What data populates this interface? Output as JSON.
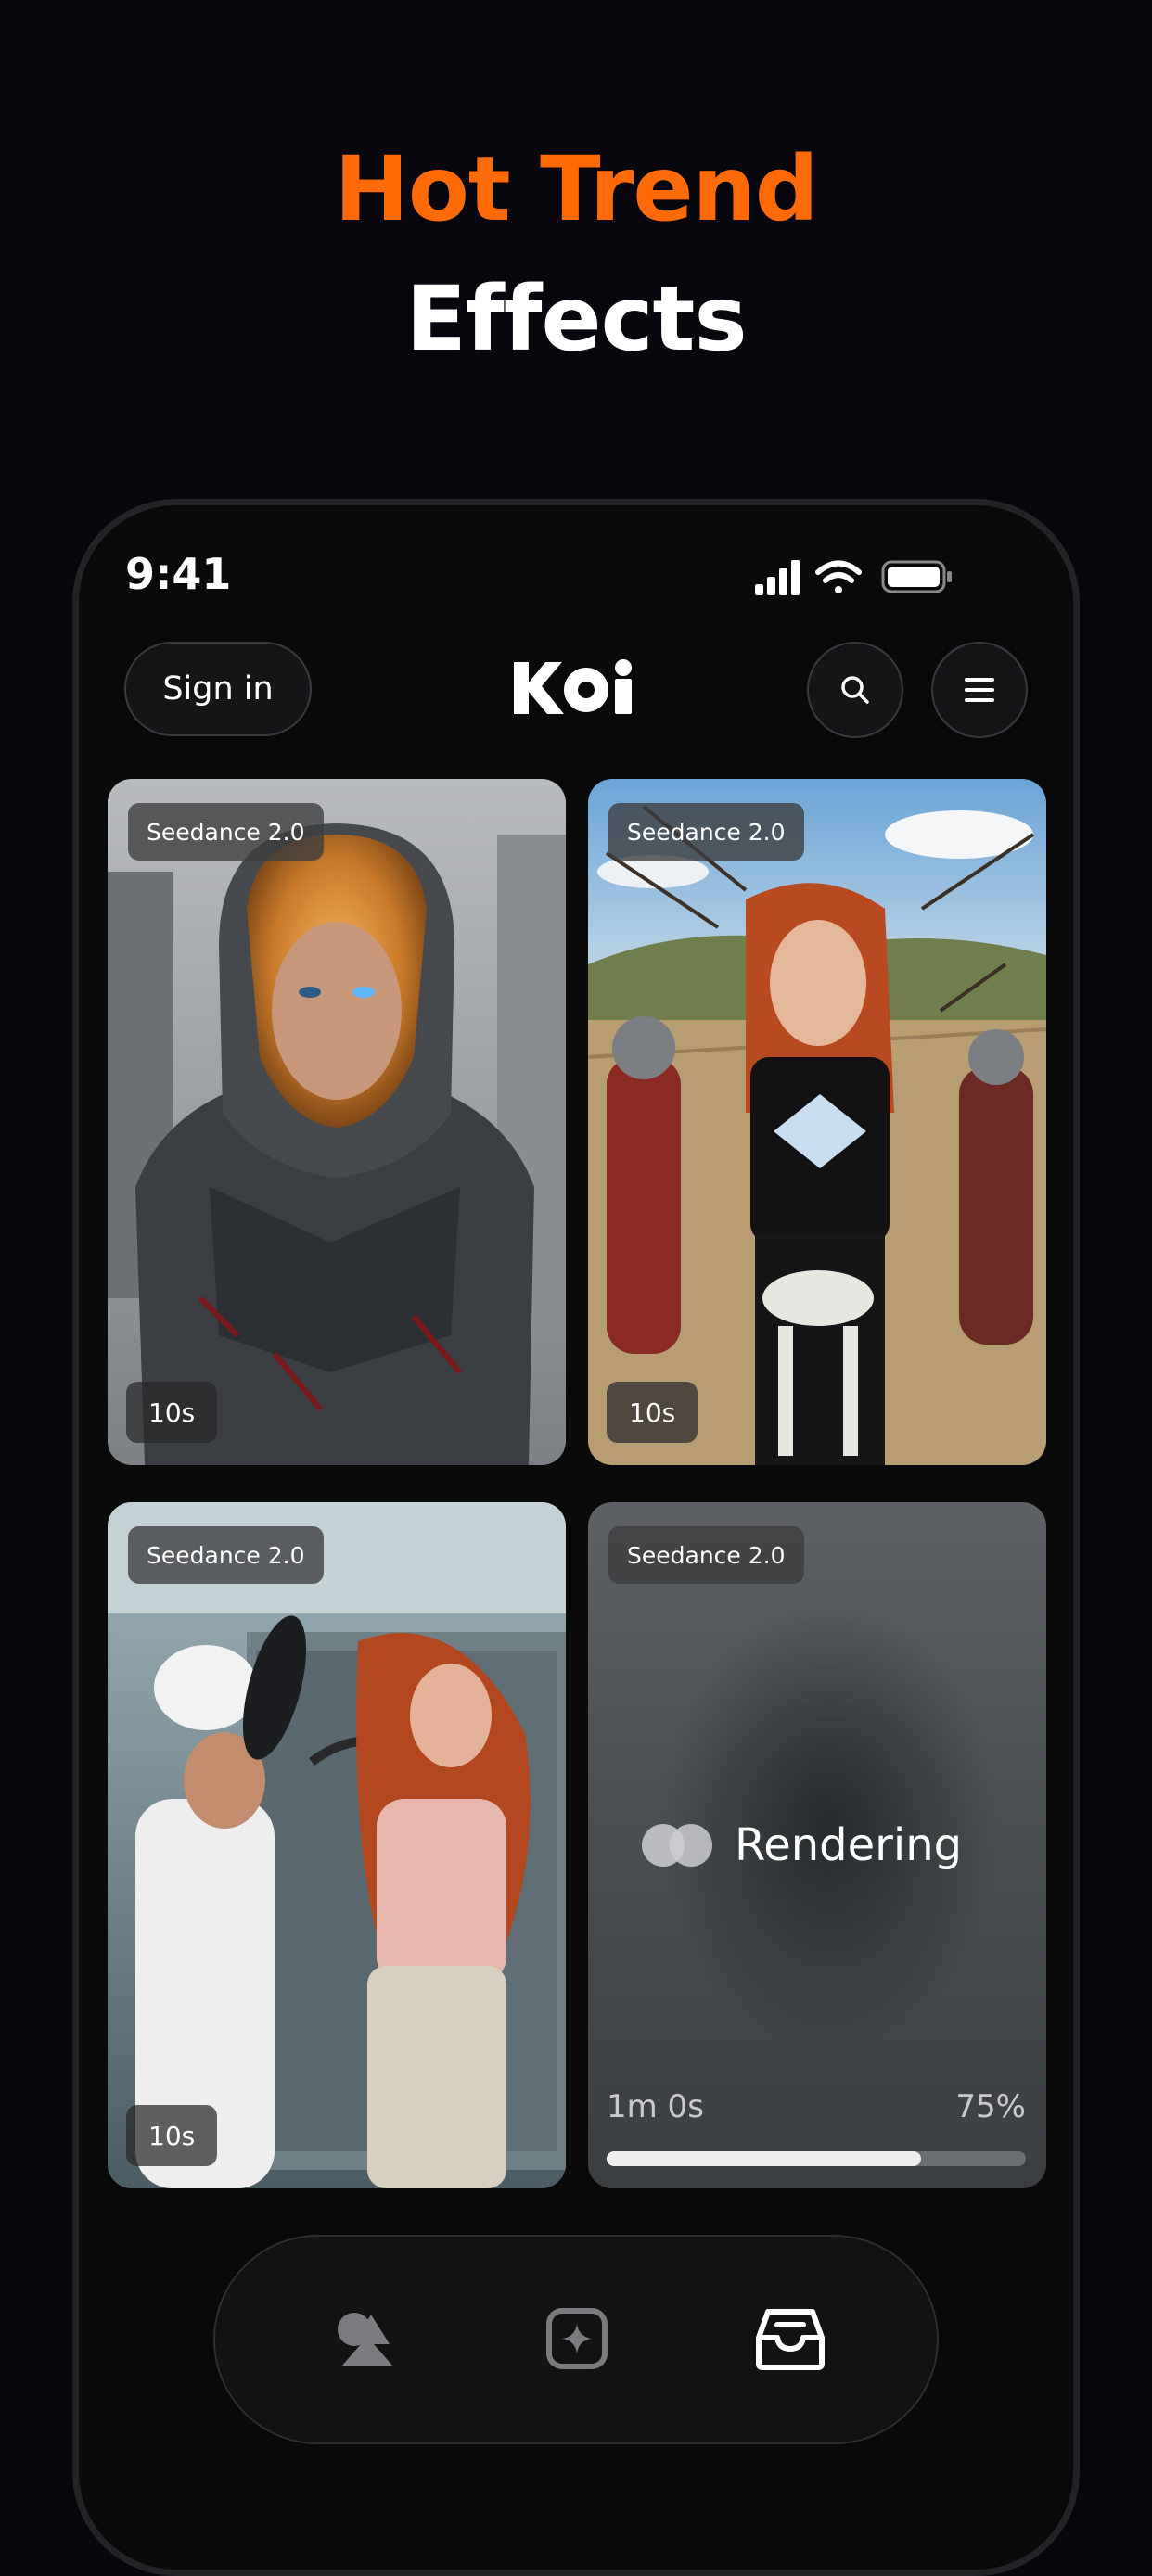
{
  "promo": {
    "line1": "Hot Trend",
    "line2": "Effects"
  },
  "status_bar": {
    "time": "9:41"
  },
  "header": {
    "sign_in_label": "Sign in",
    "logo_text": "KOi",
    "icons": [
      "search-icon",
      "menu-icon"
    ]
  },
  "cards": [
    {
      "model": "Seedance 2.0",
      "duration": "10s",
      "image": "armored soldier with glowing cracked visor"
    },
    {
      "model": "Seedance 2.0",
      "duration": "10s",
      "image": "red-haired woman among roman soldiers"
    },
    {
      "model": "Seedance 2.0",
      "duration": "10s",
      "image": "woman hitting chef with frying pan in kitchen"
    },
    {
      "model": "Seedance 2.0",
      "status": "Rendering",
      "elapsed": "1m 0s",
      "progress_label": "75%",
      "progress": 0.75
    }
  ],
  "tab_bar": {
    "tabs": [
      "shapes-icon",
      "sparkle-icon",
      "inbox-icon"
    ]
  },
  "colors": {
    "accent": "#ff6a08",
    "background": "#07070d"
  }
}
